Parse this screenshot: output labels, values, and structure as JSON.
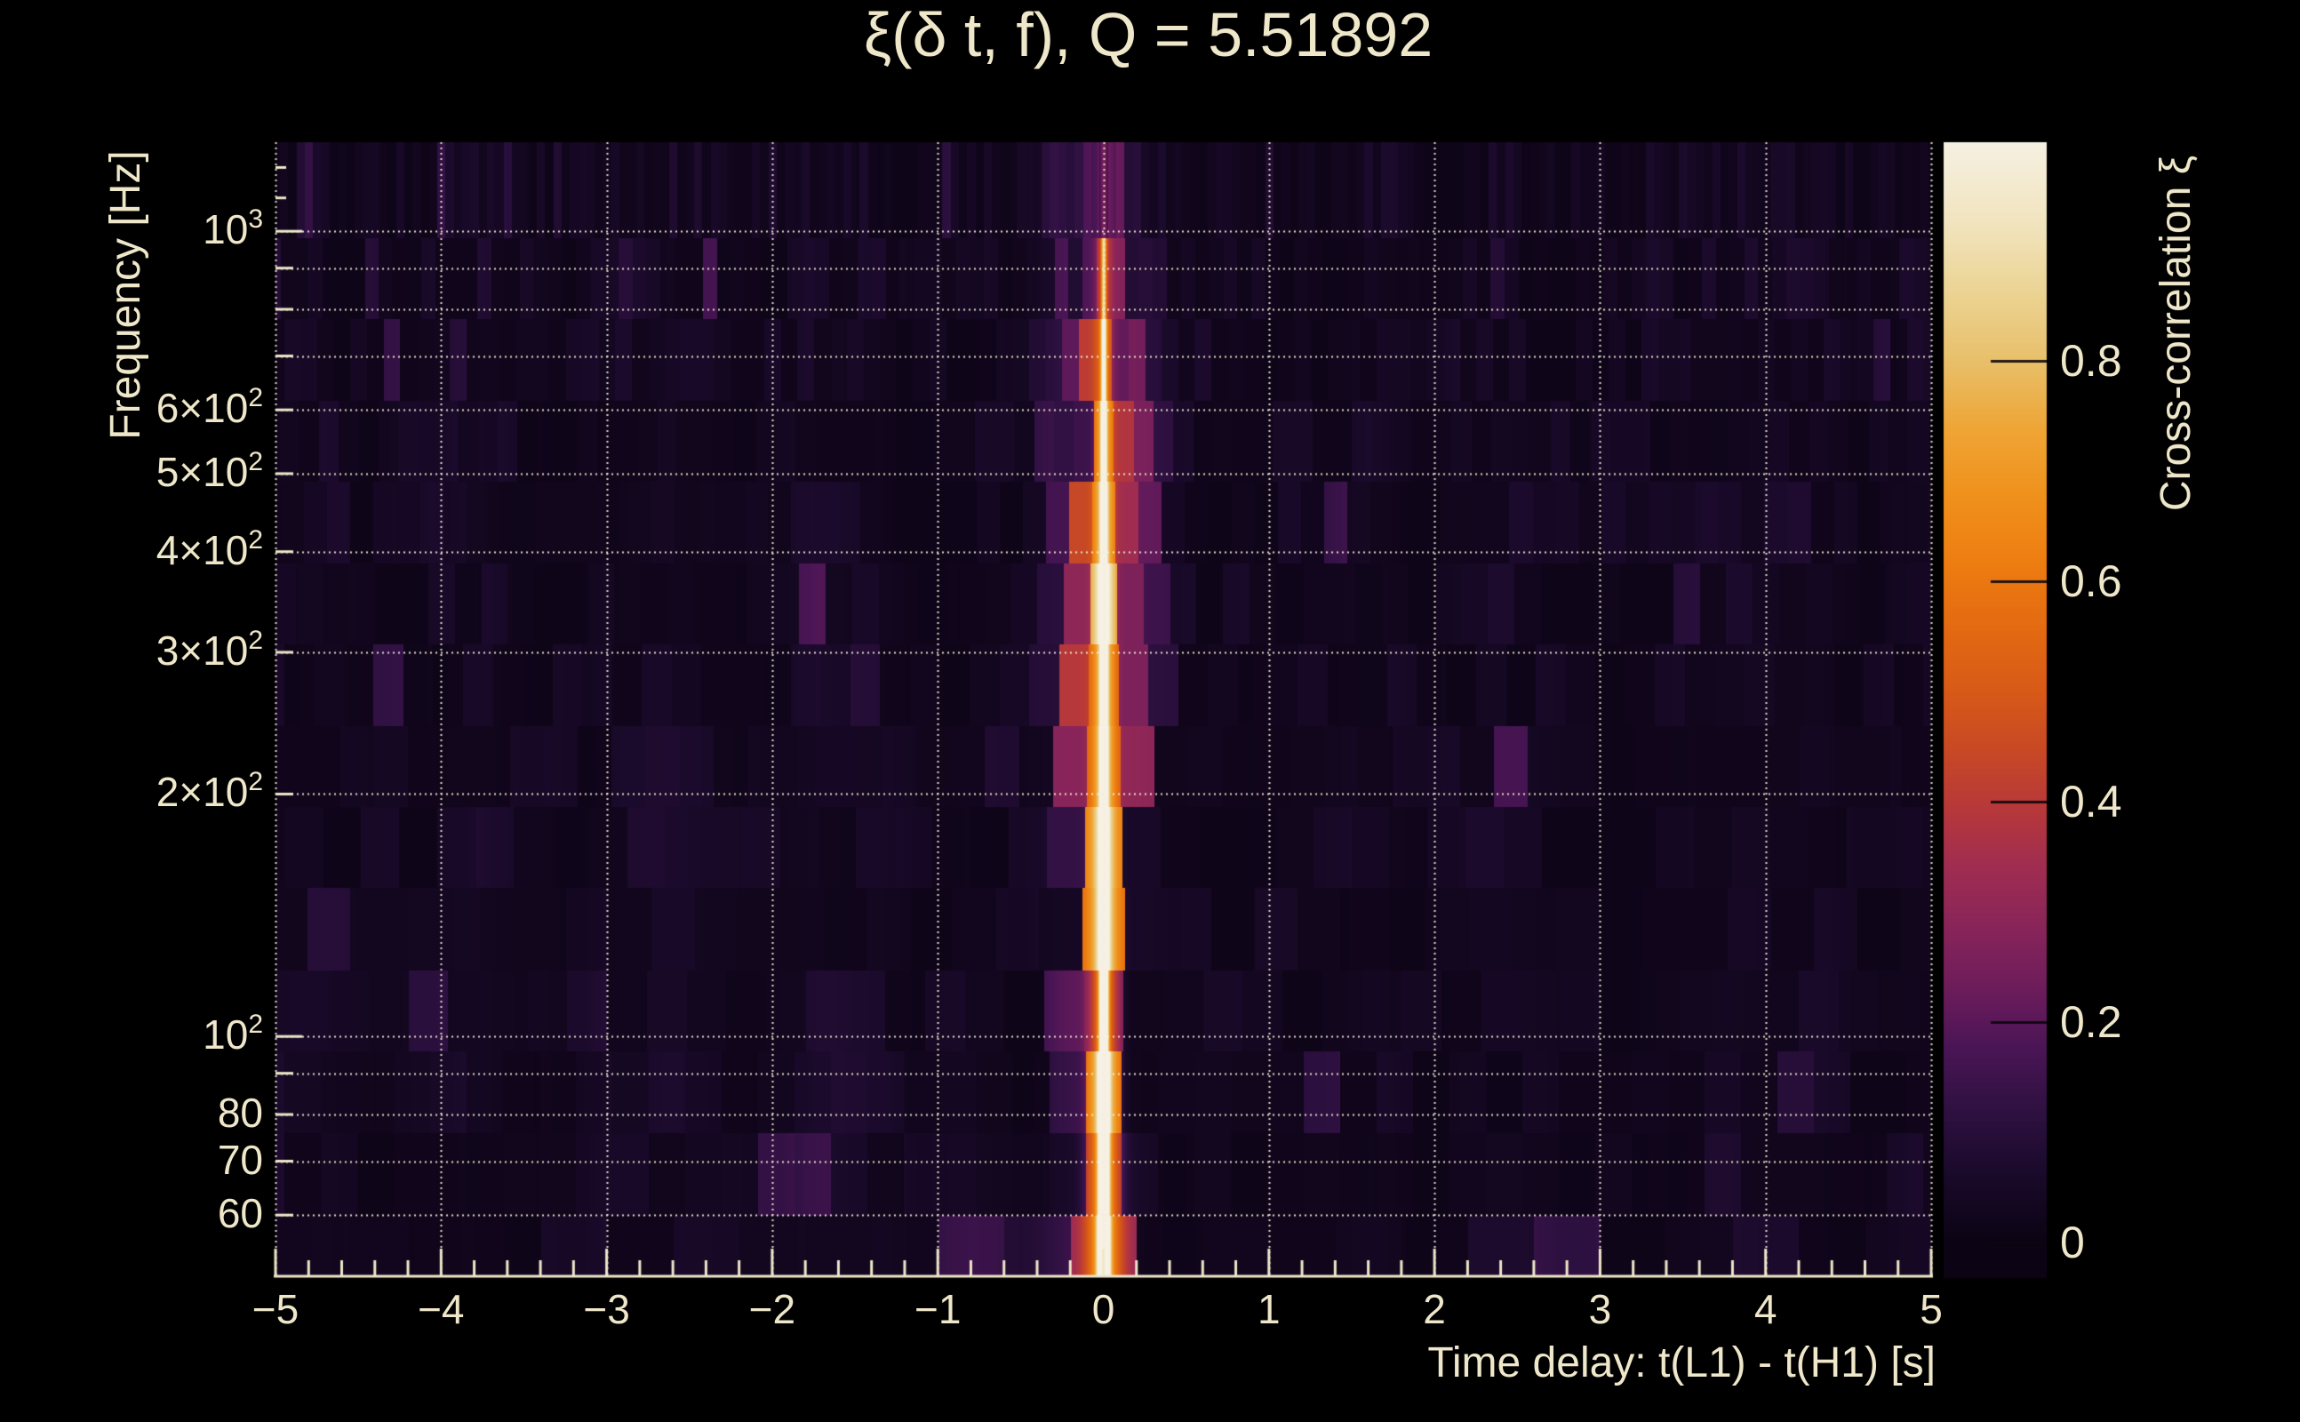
{
  "window": {
    "background": "#000000",
    "text_color": "#EFE7CA"
  },
  "chart_data": {
    "type": "heatmap",
    "title": "ξ(δ t, f), Q = 5.51892",
    "q_value": "5.51892",
    "xlabel": "Time delay: t(L1) - t(H1) [s]",
    "ylabel": "Frequency [Hz]",
    "x_range_s": [
      -5,
      5
    ],
    "x_major_tick_step_s": 1,
    "x_minor_tick_step_s": 0.2,
    "x_ticks": [
      {
        "value": -5,
        "label": "−5"
      },
      {
        "value": -4,
        "label": "−4"
      },
      {
        "value": -3,
        "label": "−3"
      },
      {
        "value": -2,
        "label": "−2"
      },
      {
        "value": -1,
        "label": "−1"
      },
      {
        "value": 0,
        "label": "0"
      },
      {
        "value": 1,
        "label": "1"
      },
      {
        "value": 2,
        "label": "2"
      },
      {
        "value": 3,
        "label": "3"
      },
      {
        "value": 4,
        "label": "4"
      },
      {
        "value": 5,
        "label": "5"
      }
    ],
    "y_scale": "log",
    "y_range_hz": [
      50.5,
      1290
    ],
    "y_ticks": [
      {
        "value": 1000,
        "base": "10",
        "exp": "3"
      },
      {
        "value": 600,
        "base": "6×10",
        "exp": "2"
      },
      {
        "value": 500,
        "base": "5×10",
        "exp": "2"
      },
      {
        "value": 400,
        "base": "4×10",
        "exp": "2"
      },
      {
        "value": 300,
        "base": "3×10",
        "exp": "2"
      },
      {
        "value": 200,
        "base": "2×10",
        "exp": "2"
      },
      {
        "value": 100,
        "base": "10",
        "exp": "2"
      },
      {
        "value": 80,
        "base": "80",
        "exp": ""
      },
      {
        "value": 70,
        "base": "70",
        "exp": ""
      },
      {
        "value": 60,
        "base": "60",
        "exp": ""
      }
    ],
    "y_minor_ticks_hz": [
      1100,
      1200
    ],
    "y_gridlines_hz": [
      60,
      70,
      80,
      90,
      100,
      200,
      300,
      400,
      500,
      600,
      700,
      800,
      900,
      1000
    ],
    "grid_style": "dotted",
    "axis_color": "#EFE7CA",
    "colorbar": {
      "label": "Cross-correlation ξ",
      "value_range": [
        -0.032,
        1.0
      ],
      "ticks": [
        {
          "value": 0,
          "label": "0"
        },
        {
          "value": 0.2,
          "label": "0.2"
        },
        {
          "value": 0.4,
          "label": "0.4"
        },
        {
          "value": 0.6,
          "label": "0.6"
        },
        {
          "value": 0.8,
          "label": "0.8"
        }
      ],
      "colormap_stops": [
        [
          0.0,
          "#0C0414"
        ],
        [
          0.06,
          "#1A0A2A"
        ],
        [
          0.12,
          "#2F1142"
        ],
        [
          0.18,
          "#4C1656"
        ],
        [
          0.22,
          "#671B5B"
        ],
        [
          0.28,
          "#86245A"
        ],
        [
          0.34,
          "#A02D52"
        ],
        [
          0.4,
          "#BA3A38"
        ],
        [
          0.45,
          "#C94A24"
        ],
        [
          0.5,
          "#D85A18"
        ],
        [
          0.57,
          "#E66E11"
        ],
        [
          0.62,
          "#EE7F12"
        ],
        [
          0.68,
          "#F0921D"
        ],
        [
          0.74,
          "#EFA637"
        ],
        [
          0.8,
          "#E8C06A"
        ],
        [
          0.86,
          "#ECD392"
        ],
        [
          0.92,
          "#F1E3BB"
        ],
        [
          1.0,
          "#F6F1E4"
        ]
      ]
    },
    "signal": {
      "description": "Narrow cross-correlation ridge at zero time delay between L1 and H1, brightest below 100 Hz and between 150 and 400 Hz, with quantized side-lobe stripes within ±0.25 s and faint noise columns elsewhere",
      "peak_time_delay_s": 0,
      "peak_correlation": 1.0,
      "sidelobe_time_delays_s": [
        -0.15,
        0.16
      ],
      "noise_floor_correlation": [
        0.0,
        0.12
      ],
      "bands": [
        {
          "f_low_hz": 50.5,
          "f_high_hz": 60,
          "core_amp": 1.0,
          "core_sigma_s": 0.034,
          "wing_amp": 0.55,
          "wing_sigma_s": 0.16,
          "tile_width_s": 0.4
        },
        {
          "f_low_hz": 60,
          "f_high_hz": 76,
          "core_amp": 1.0,
          "core_sigma_s": 0.03,
          "wing_amp": 0.42,
          "wing_sigma_s": 0.09,
          "tile_width_s": 0.22
        },
        {
          "f_low_hz": 76,
          "f_high_hz": 96,
          "core_amp": 0.99,
          "core_sigma_s": 0.027,
          "wing_amp": 0.4,
          "wing_sigma_s": 0.09,
          "tile_width_s": 0.22
        },
        {
          "f_low_hz": 96,
          "f_high_hz": 121,
          "core_amp": 0.96,
          "core_sigma_s": 0.025,
          "wing_amp": 0.4,
          "wing_sigma_s": 0.12,
          "tile_width_s": 0.24
        },
        {
          "f_low_hz": 121,
          "f_high_hz": 153,
          "core_amp": 0.93,
          "core_sigma_s": 0.023,
          "wing_amp": 0.42,
          "wing_sigma_s": 0.14,
          "tile_width_s": 0.26
        },
        {
          "f_low_hz": 153,
          "f_high_hz": 193,
          "core_amp": 0.9,
          "core_sigma_s": 0.021,
          "wing_amp": 0.46,
          "wing_sigma_s": 0.17,
          "tile_width_s": 0.23
        },
        {
          "f_low_hz": 193,
          "f_high_hz": 243,
          "core_amp": 0.88,
          "core_sigma_s": 0.02,
          "wing_amp": 0.5,
          "wing_sigma_s": 0.2,
          "tile_width_s": 0.205
        },
        {
          "f_low_hz": 243,
          "f_high_hz": 307,
          "core_amp": 0.85,
          "core_sigma_s": 0.019,
          "wing_amp": 0.52,
          "wing_sigma_s": 0.24,
          "tile_width_s": 0.18
        },
        {
          "f_low_hz": 307,
          "f_high_hz": 387,
          "core_amp": 0.82,
          "core_sigma_s": 0.018,
          "wing_amp": 0.5,
          "wing_sigma_s": 0.26,
          "tile_width_s": 0.16
        },
        {
          "f_low_hz": 387,
          "f_high_hz": 489,
          "core_amp": 0.74,
          "core_sigma_s": 0.017,
          "wing_amp": 0.44,
          "wing_sigma_s": 0.26,
          "tile_width_s": 0.14
        },
        {
          "f_low_hz": 489,
          "f_high_hz": 617,
          "core_amp": 0.63,
          "core_sigma_s": 0.016,
          "wing_amp": 0.36,
          "wing_sigma_s": 0.26,
          "tile_width_s": 0.12
        },
        {
          "f_low_hz": 617,
          "f_high_hz": 778,
          "core_amp": 0.53,
          "core_sigma_s": 0.016,
          "wing_amp": 0.29,
          "wing_sigma_s": 0.27,
          "tile_width_s": 0.1
        },
        {
          "f_low_hz": 778,
          "f_high_hz": 982,
          "core_amp": 0.45,
          "core_sigma_s": 0.015,
          "wing_amp": 0.22,
          "wing_sigma_s": 0.27,
          "tile_width_s": 0.085
        },
        {
          "f_low_hz": 982,
          "f_high_hz": 1290,
          "core_amp": 0.13,
          "core_sigma_s": 0.02,
          "wing_amp": 0.1,
          "wing_sigma_s": 0.32,
          "tile_width_s": 0.05
        }
      ]
    }
  }
}
